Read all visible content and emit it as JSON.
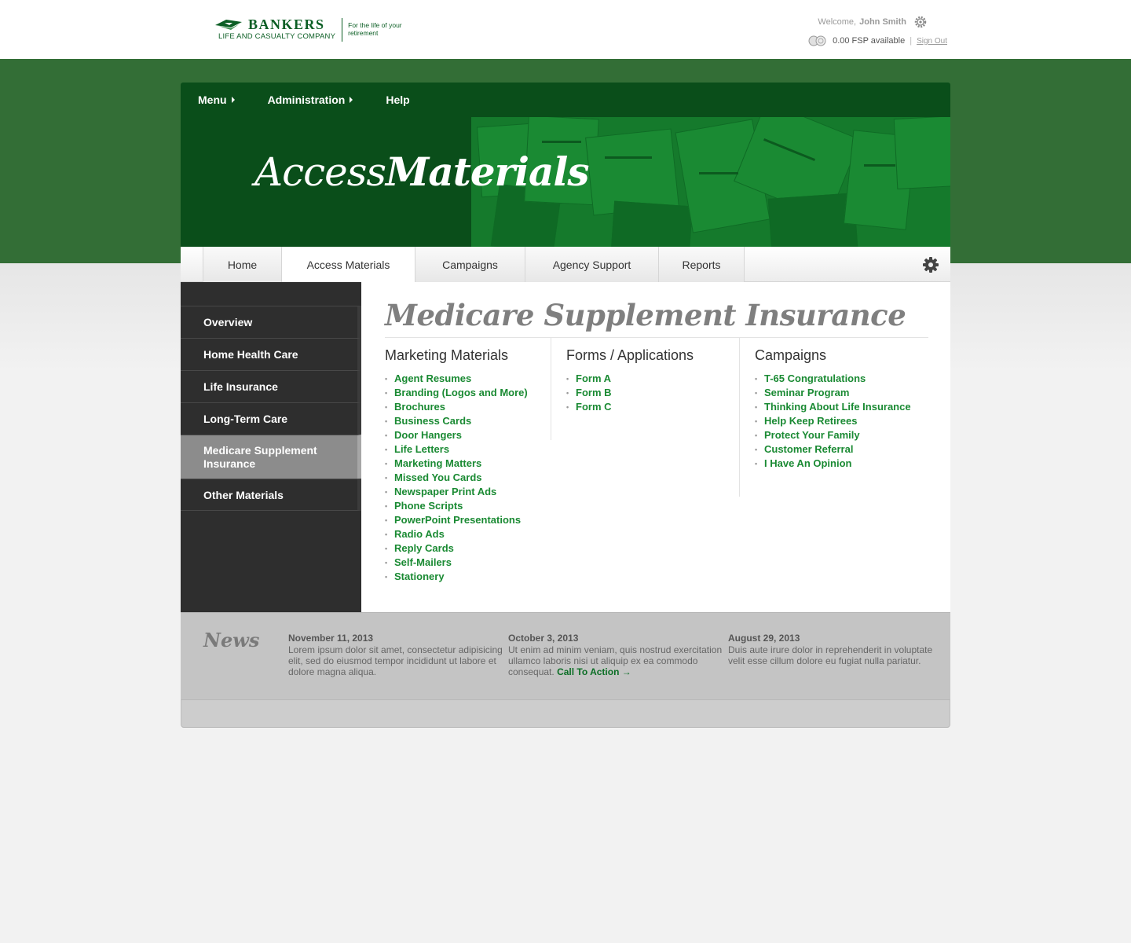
{
  "header": {
    "logo_name": "BANKERS",
    "logo_sub": "LIFE AND CASUALTY COMPANY",
    "logo_tagline": "For the life of your retirement",
    "welcome_label": "Welcome,",
    "user_name": "John Smith",
    "fsp_text": "0.00 FSP available",
    "separator": "|",
    "sign_out": "Sign Out"
  },
  "topnav": {
    "menu": "Menu",
    "administration": "Administration",
    "help": "Help"
  },
  "hero": {
    "title_part1": "Access",
    "title_part2": "Materials"
  },
  "tabs": [
    "Home",
    "Access Materials",
    "Campaigns",
    "Agency Support",
    "Reports"
  ],
  "sidebar": {
    "items": [
      {
        "label": "Overview"
      },
      {
        "label": "Home Health Care"
      },
      {
        "label": "Life Insurance"
      },
      {
        "label": "Long-Term Care"
      },
      {
        "label": "Medicare Supplement Insurance"
      },
      {
        "label": "Other Materials"
      }
    ]
  },
  "content": {
    "title": "Medicare Supplement Insurance",
    "marketing": {
      "heading": "Marketing Materials",
      "items": [
        "Agent Resumes",
        "Branding (Logos and More)",
        "Brochures",
        "Business Cards",
        "Door Hangers",
        "Life Letters",
        "Marketing Matters",
        "Missed You Cards",
        "Newspaper Print Ads",
        "Phone Scripts",
        "PowerPoint Presentations",
        "Radio Ads",
        "Reply Cards",
        "Self-Mailers",
        "Stationery"
      ]
    },
    "forms": {
      "heading": "Forms / Applications",
      "items": [
        "Form A",
        "Form B",
        "Form C"
      ]
    },
    "campaigns": {
      "heading": "Campaigns",
      "items": [
        "T-65 Congratulations",
        "Seminar Program",
        "Thinking About Life Insurance",
        "Help Keep Retirees",
        "Protect Your Family",
        "Customer Referral",
        "I Have An Opinion"
      ]
    }
  },
  "news": {
    "title": "News",
    "items": [
      {
        "date": "November 11, 2013",
        "text": "Lorem ipsum dolor sit amet, consectetur adipisicing elit, sed do eiusmod tempor incididunt ut labore et dolore magna aliqua.",
        "link": ""
      },
      {
        "date": "October 3, 2013",
        "text": "Ut enim ad minim veniam, quis nostrud exercitation ullamco laboris nisi ut aliquip ex ea commodo consequat.",
        "link": "Call To Action →"
      },
      {
        "date": "August 29, 2013",
        "text": "Duis aute irure dolor in reprehenderit in voluptate velit esse cillum dolore eu fugiat nulla pariatur.",
        "link": ""
      }
    ]
  },
  "colors": {
    "brand_green": "#0b5e24",
    "band_green": "#336e36",
    "link_green": "#1a8a33",
    "sidebar_dark": "#2e2e2e",
    "sidebar_active": "#8c8c8c"
  }
}
